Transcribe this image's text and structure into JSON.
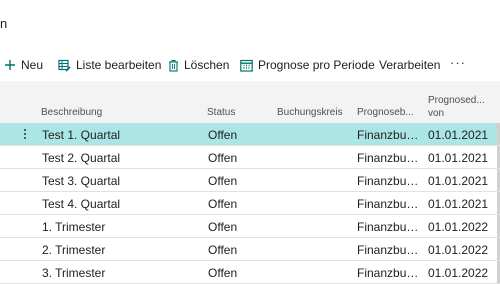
{
  "page": {
    "title_fragment": "n"
  },
  "actions": {
    "new": "Neu",
    "edit_list": "Liste bearbeiten",
    "delete": "Löschen",
    "forecast_by_period": "Prognose pro Periode",
    "process": "Verarbeiten",
    "more": "···"
  },
  "icons": {
    "new": "plus-icon",
    "edit_list": "edit-list-icon",
    "delete": "trash-icon",
    "forecast_by_period": "calendar-grid-icon",
    "more": "ellipsis-icon"
  },
  "colors": {
    "accent": "#00726d",
    "selected_row": "#ace5e5"
  },
  "table": {
    "headers": {
      "description": "Beschreibung",
      "status": "Status",
      "company_code": "Buchungskreis",
      "forecast_type": "Prognoseb...",
      "forecast_date_1": "Prognosed...",
      "forecast_date_2": "von"
    },
    "rows": [
      {
        "description": "Test 1. Quartal",
        "status": "Offen",
        "company_code": "",
        "forecast_type": "Finanzbuchhaltung",
        "date": "01.01.2021",
        "selected": true
      },
      {
        "description": "Test 2. Quartal",
        "status": "Offen",
        "company_code": "",
        "forecast_type": "Finanzbuchhaltung",
        "date": "01.01.2021"
      },
      {
        "description": "Test 3. Quartal",
        "status": "Offen",
        "company_code": "",
        "forecast_type": "Finanzbuchhaltung",
        "date": "01.01.2021"
      },
      {
        "description": "Test 4. Quartal",
        "status": "Offen",
        "company_code": "",
        "forecast_type": "Finanzbuchhaltung",
        "date": "01.01.2021"
      },
      {
        "description": "1. Trimester",
        "status": "Offen",
        "company_code": "",
        "forecast_type": "Finanzbuchhaltung",
        "date": "01.01.2022"
      },
      {
        "description": "2. Trimester",
        "status": "Offen",
        "company_code": "",
        "forecast_type": "Finanzbuchhaltung",
        "date": "01.01.2022"
      },
      {
        "description": "3. Trimester",
        "status": "Offen",
        "company_code": "",
        "forecast_type": "Finanzbuchhaltung",
        "date": "01.01.2022"
      }
    ]
  }
}
